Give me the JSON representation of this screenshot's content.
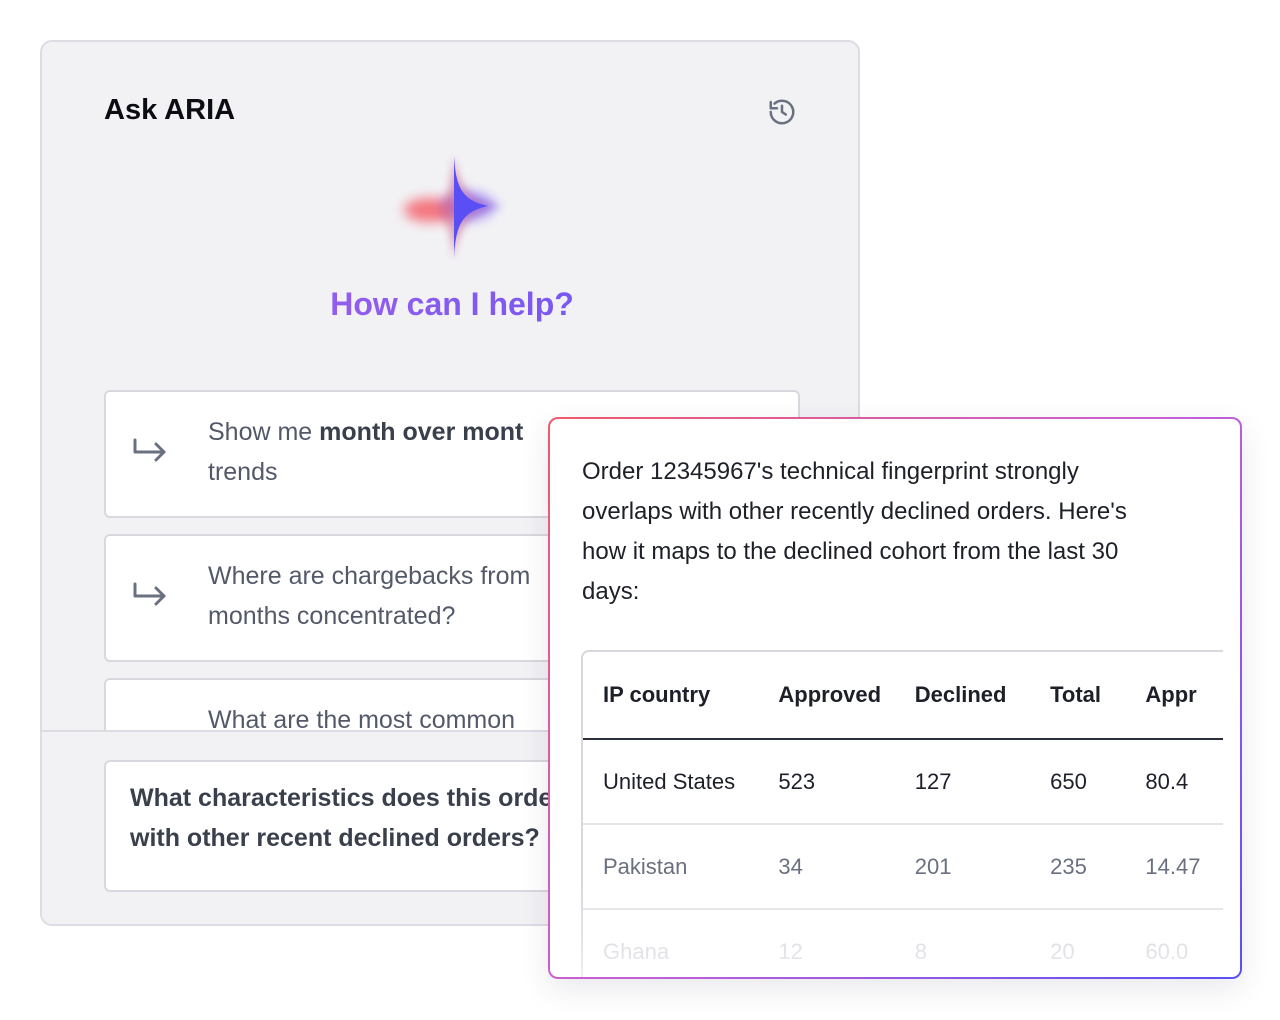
{
  "panel": {
    "title": "Ask ARIA",
    "history_icon": "history-icon",
    "logo_icon": "sparkle-logo-icon",
    "heading": "How can I help?"
  },
  "suggestions": [
    {
      "prefix": "Show me ",
      "bold": "month over mont",
      "rest": "",
      "line2": "trends",
      "icon": "arrow-return-icon"
    },
    {
      "prefix": "Where are chargebacks from",
      "bold": "",
      "rest": "",
      "line2": "months concentrated?",
      "icon": "arrow-return-icon"
    },
    {
      "prefix": "What are the most common",
      "bold": "",
      "rest": "",
      "line2": "",
      "icon": "arrow-return-icon"
    }
  ],
  "composer": {
    "text": "What characteristics does this order have in common with other recent declined orders?"
  },
  "response": {
    "message": "Order 12345967's technical fingerprint strongly overlaps with other recently declined orders. Here's how it maps to the declined cohort from the last 30 days:",
    "table": {
      "headers": [
        "IP country",
        "Approved",
        "Declined",
        "Total",
        "Appr"
      ],
      "rows": [
        [
          "United States",
          "523",
          "127",
          "650",
          "80.4"
        ],
        [
          "Pakistan",
          "34",
          "201",
          "235",
          "14.47"
        ],
        [
          "Ghana",
          "12",
          "8",
          "20",
          "60.0"
        ]
      ]
    }
  },
  "colors": {
    "accent_start": "#ef5a6a",
    "accent_mid": "#b25be8",
    "accent_end": "#5a4ff5"
  }
}
